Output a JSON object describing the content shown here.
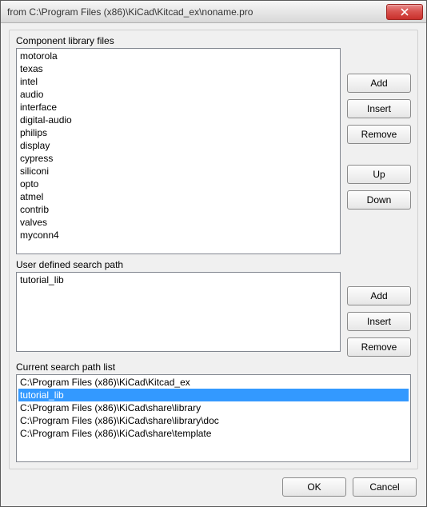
{
  "window": {
    "title": "from C:\\Program Files (x86)\\KiCad\\Kitcad_ex\\noname.pro"
  },
  "sections": {
    "componentLibs": {
      "label": "Component library files",
      "items": [
        "motorola",
        "texas",
        "intel",
        "audio",
        "interface",
        "digital-audio",
        "philips",
        "display",
        "cypress",
        "siliconi",
        "opto",
        "atmel",
        "contrib",
        "valves",
        "myconn4"
      ],
      "buttons": {
        "add": "Add",
        "insert": "Insert",
        "remove": "Remove",
        "up": "Up",
        "down": "Down"
      }
    },
    "userSearchPath": {
      "label": "User defined search path",
      "items": [
        "tutorial_lib"
      ],
      "buttons": {
        "add": "Add",
        "insert": "Insert",
        "remove": "Remove"
      }
    },
    "currentPaths": {
      "label": "Current search path list",
      "items": [
        "C:\\Program Files (x86)\\KiCad\\Kitcad_ex",
        "tutorial_lib",
        "C:\\Program Files (x86)\\KiCad\\share\\library",
        "C:\\Program Files (x86)\\KiCad\\share\\library\\doc",
        "C:\\Program Files (x86)\\KiCad\\share\\template"
      ],
      "selectedIndex": 1
    }
  },
  "footer": {
    "ok": "OK",
    "cancel": "Cancel"
  }
}
